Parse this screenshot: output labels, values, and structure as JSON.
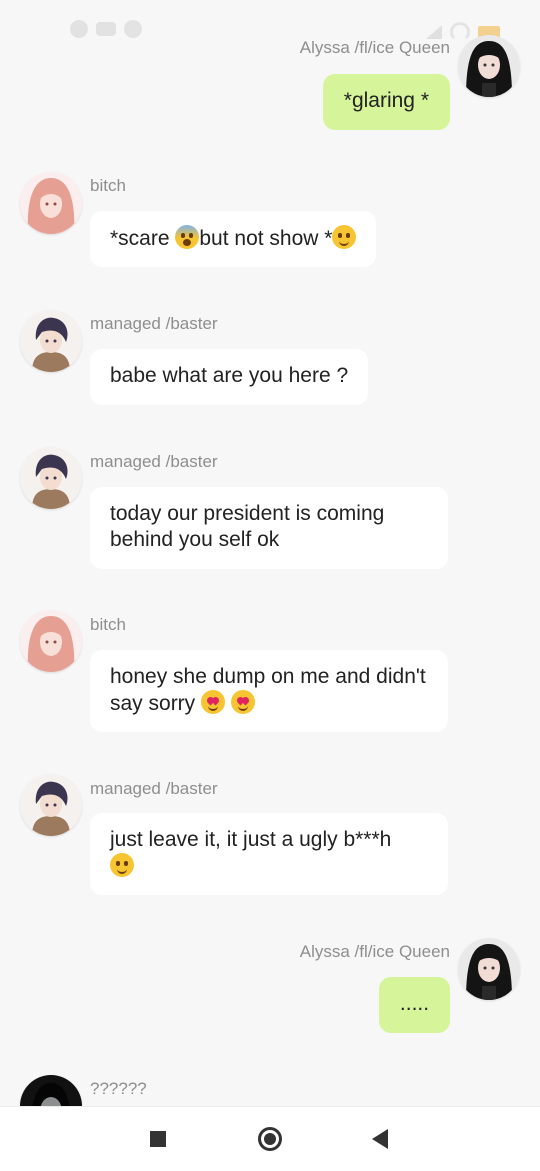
{
  "messages": [
    {
      "sender": "Alyssa /fl/ice Queen",
      "text": "*glaring *",
      "side": "right",
      "avatar": "dark-haired-girl-avatar"
    },
    {
      "sender": "bitch",
      "text": "*scare ",
      "text2": "but not show *",
      "side": "left",
      "avatar": "pink-haired-girl-avatar"
    },
    {
      "sender": "managed /baster",
      "text": "babe what are you here ?",
      "side": "left",
      "avatar": "dark-haired-boy-avatar"
    },
    {
      "sender": "managed /baster",
      "text": "today our president is coming behind you self ok",
      "side": "left",
      "avatar": "dark-haired-boy-avatar"
    },
    {
      "sender": "bitch",
      "text": "honey she dump on me and didn't say sorry ",
      "side": "left",
      "avatar": "pink-haired-girl-avatar"
    },
    {
      "sender": "managed /baster",
      "text": "just leave it, it just a ugly b***h ",
      "side": "left",
      "avatar": "dark-haired-boy-avatar"
    },
    {
      "sender": "Alyssa /fl/ice Queen",
      "text": ".....",
      "side": "right",
      "avatar": "dark-haired-girl-avatar"
    },
    {
      "sender": "??????",
      "text": "",
      "side": "left",
      "avatar": "pale-face-avatar"
    }
  ],
  "colors": {
    "background": "#f7f7f7",
    "own_bubble": "#d6f59a",
    "other_bubble": "#ffffff",
    "sender_name": "#8e8e8e"
  },
  "icons": [
    "nav-recent-apps-icon",
    "nav-home-icon",
    "nav-back-icon"
  ]
}
